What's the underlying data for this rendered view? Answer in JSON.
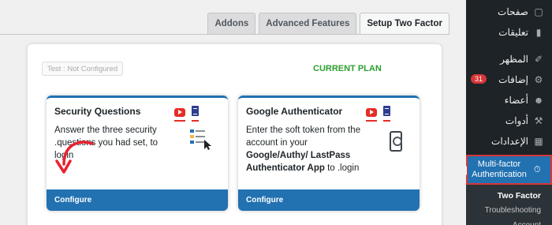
{
  "tabs": [
    "Addons",
    "Advanced Features",
    "Setup Two Factor"
  ],
  "active_tab": 2,
  "panel": {
    "test_badge": "Test : Not Configured",
    "current_plan": "CURRENT PLAN"
  },
  "cards": [
    {
      "title": "Security Questions",
      "description": "Answer the three security .questions you had set, to login",
      "footer": "Configure"
    },
    {
      "title": "Google Authenticator",
      "description_pre": "Enter the soft token from the account in your ",
      "description_bold": "Google/Authy/ LastPass Authenticator App",
      "description_post": " to .login",
      "footer": "Configure"
    }
  ],
  "sidebar": {
    "items": [
      {
        "label": "صفحات",
        "icon": "pages-icon"
      },
      {
        "label": "تعليقات",
        "icon": "comments-icon"
      },
      {
        "label": "المظهر",
        "icon": "appearance-icon"
      },
      {
        "label": "إضافات",
        "icon": "plugins-icon",
        "badge": "31"
      },
      {
        "label": "أعضاء",
        "icon": "users-icon"
      },
      {
        "label": "أدوات",
        "icon": "tools-icon"
      },
      {
        "label": "الإعدادات",
        "icon": "settings-icon"
      }
    ],
    "mfa_label": "Multi-factor Authentication",
    "submenu": [
      "Two Factor",
      "Troubleshooting",
      "Account"
    ]
  },
  "colors": {
    "accent": "#2271b1",
    "plan_green": "#2e9e2e",
    "highlight_red": "#d63638",
    "sidebar_bg": "#1d2327"
  }
}
